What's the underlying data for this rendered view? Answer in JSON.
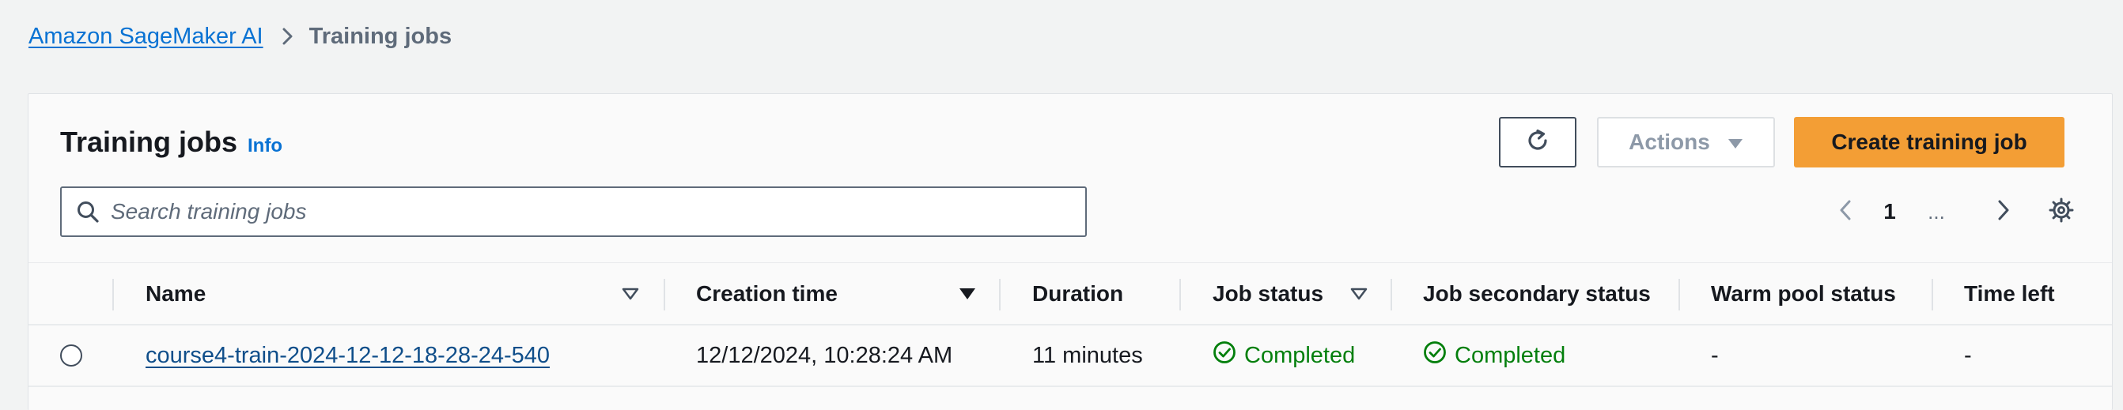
{
  "breadcrumb": {
    "root": "Amazon SageMaker AI",
    "current": "Training jobs"
  },
  "header": {
    "title": "Training jobs",
    "info": "Info",
    "actions_label": "Actions",
    "create_label": "Create training job"
  },
  "search": {
    "placeholder": "Search training jobs",
    "value": ""
  },
  "pagination": {
    "current_page": "1",
    "ellipsis": "..."
  },
  "table": {
    "columns": [
      "Name",
      "Creation time",
      "Duration",
      "Job status",
      "Job secondary status",
      "Warm pool status",
      "Time left"
    ],
    "rows": [
      {
        "name": "course4-train-2024-12-12-18-28-24-540",
        "creation_time": "12/12/2024, 10:28:24 AM",
        "duration": "11 minutes",
        "job_status": "Completed",
        "secondary_status": "Completed",
        "warm_pool_status": "-",
        "time_left": "-"
      }
    ]
  },
  "icons": {
    "breadcrumb_separator": "chevron-right-icon",
    "refresh": "refresh-icon",
    "actions_caret": "caret-down-icon",
    "search": "search-icon",
    "prev": "chevron-left-icon",
    "next": "chevron-right-icon",
    "settings": "gear-icon",
    "status": "check-circle-icon"
  },
  "colors": {
    "link": "#0972d3",
    "primary_button": "#f39e35",
    "success": "#037f0c",
    "background": "#f2f3f3"
  }
}
